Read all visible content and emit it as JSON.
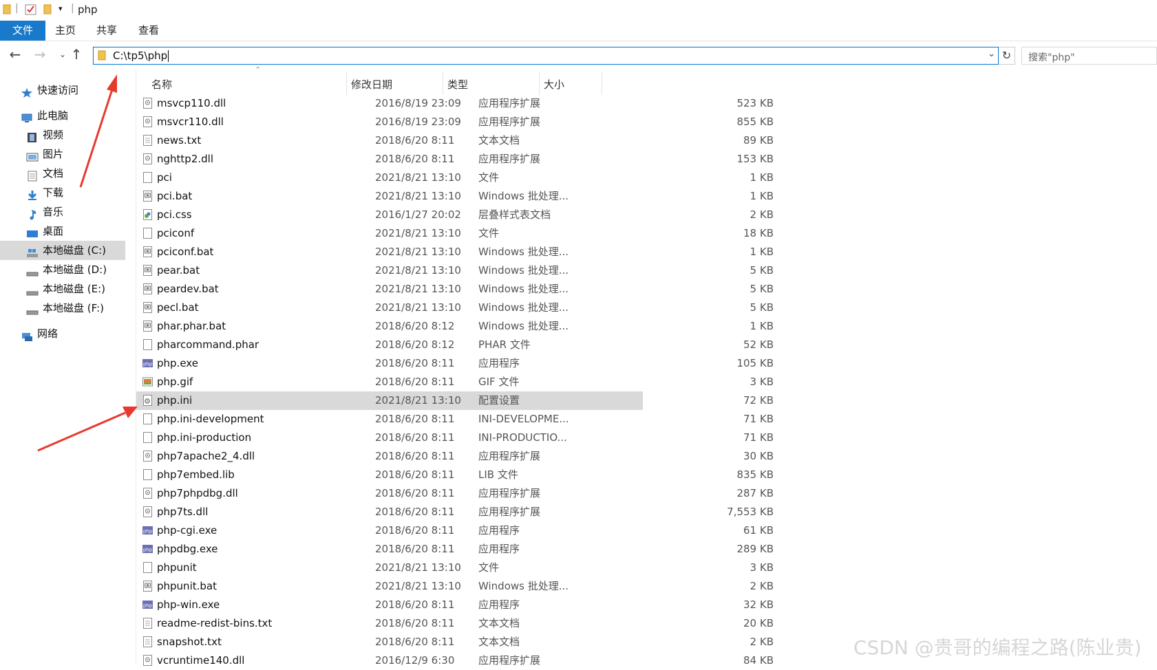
{
  "window": {
    "title": "php"
  },
  "ribbon": {
    "tabs": [
      "文件",
      "主页",
      "共享",
      "查看"
    ]
  },
  "address": {
    "path": "C:\\tp5\\php"
  },
  "search": {
    "placeholder": "搜索\"php\""
  },
  "nav": {
    "quick_access": "快速访问",
    "this_pc": "此电脑",
    "items": [
      "视频",
      "图片",
      "文档",
      "下载",
      "音乐",
      "桌面"
    ],
    "drives": [
      "本地磁盘 (C:)",
      "本地磁盘 (D:)",
      "本地磁盘 (E:)",
      "本地磁盘 (F:)"
    ],
    "network": "网络"
  },
  "columns": {
    "name": "名称",
    "date": "修改日期",
    "type": "类型",
    "size": "大小"
  },
  "files": [
    {
      "name": "msvcp110.dll",
      "date": "2016/8/19 23:09",
      "type": "应用程序扩展",
      "size": "523 KB",
      "icon": "dll"
    },
    {
      "name": "msvcr110.dll",
      "date": "2016/8/19 23:09",
      "type": "应用程序扩展",
      "size": "855 KB",
      "icon": "dll"
    },
    {
      "name": "news.txt",
      "date": "2018/6/20 8:11",
      "type": "文本文档",
      "size": "89 KB",
      "icon": "txt"
    },
    {
      "name": "nghttp2.dll",
      "date": "2018/6/20 8:11",
      "type": "应用程序扩展",
      "size": "153 KB",
      "icon": "dll"
    },
    {
      "name": "pci",
      "date": "2021/8/21 13:10",
      "type": "文件",
      "size": "1 KB",
      "icon": "blank"
    },
    {
      "name": "pci.bat",
      "date": "2021/8/21 13:10",
      "type": "Windows 批处理...",
      "size": "1 KB",
      "icon": "bat"
    },
    {
      "name": "pci.css",
      "date": "2016/1/27 20:02",
      "type": "层叠样式表文档",
      "size": "2 KB",
      "icon": "css"
    },
    {
      "name": "pciconf",
      "date": "2021/8/21 13:10",
      "type": "文件",
      "size": "18 KB",
      "icon": "blank"
    },
    {
      "name": "pciconf.bat",
      "date": "2021/8/21 13:10",
      "type": "Windows 批处理...",
      "size": "1 KB",
      "icon": "bat"
    },
    {
      "name": "pear.bat",
      "date": "2021/8/21 13:10",
      "type": "Windows 批处理...",
      "size": "5 KB",
      "icon": "bat"
    },
    {
      "name": "peardev.bat",
      "date": "2021/8/21 13:10",
      "type": "Windows 批处理...",
      "size": "5 KB",
      "icon": "bat"
    },
    {
      "name": "pecl.bat",
      "date": "2021/8/21 13:10",
      "type": "Windows 批处理...",
      "size": "5 KB",
      "icon": "bat"
    },
    {
      "name": "phar.phar.bat",
      "date": "2018/6/20 8:12",
      "type": "Windows 批处理...",
      "size": "1 KB",
      "icon": "bat"
    },
    {
      "name": "pharcommand.phar",
      "date": "2018/6/20 8:12",
      "type": "PHAR 文件",
      "size": "52 KB",
      "icon": "blank"
    },
    {
      "name": "php.exe",
      "date": "2018/6/20 8:11",
      "type": "应用程序",
      "size": "105 KB",
      "icon": "php"
    },
    {
      "name": "php.gif",
      "date": "2018/6/20 8:11",
      "type": "GIF 文件",
      "size": "3 KB",
      "icon": "gif"
    },
    {
      "name": "php.ini",
      "date": "2021/8/21 13:10",
      "type": "配置设置",
      "size": "72 KB",
      "icon": "ini",
      "selected": true
    },
    {
      "name": "php.ini-development",
      "date": "2018/6/20 8:11",
      "type": "INI-DEVELOPME...",
      "size": "71 KB",
      "icon": "blank"
    },
    {
      "name": "php.ini-production",
      "date": "2018/6/20 8:11",
      "type": "INI-PRODUCTIO...",
      "size": "71 KB",
      "icon": "blank"
    },
    {
      "name": "php7apache2_4.dll",
      "date": "2018/6/20 8:11",
      "type": "应用程序扩展",
      "size": "30 KB",
      "icon": "dll"
    },
    {
      "name": "php7embed.lib",
      "date": "2018/6/20 8:11",
      "type": "LIB 文件",
      "size": "835 KB",
      "icon": "blank"
    },
    {
      "name": "php7phpdbg.dll",
      "date": "2018/6/20 8:11",
      "type": "应用程序扩展",
      "size": "287 KB",
      "icon": "dll"
    },
    {
      "name": "php7ts.dll",
      "date": "2018/6/20 8:11",
      "type": "应用程序扩展",
      "size": "7,553 KB",
      "icon": "dll"
    },
    {
      "name": "php-cgi.exe",
      "date": "2018/6/20 8:11",
      "type": "应用程序",
      "size": "61 KB",
      "icon": "php"
    },
    {
      "name": "phpdbg.exe",
      "date": "2018/6/20 8:11",
      "type": "应用程序",
      "size": "289 KB",
      "icon": "php"
    },
    {
      "name": "phpunit",
      "date": "2021/8/21 13:10",
      "type": "文件",
      "size": "3 KB",
      "icon": "blank"
    },
    {
      "name": "phpunit.bat",
      "date": "2021/8/21 13:10",
      "type": "Windows 批处理...",
      "size": "2 KB",
      "icon": "bat"
    },
    {
      "name": "php-win.exe",
      "date": "2018/6/20 8:11",
      "type": "应用程序",
      "size": "32 KB",
      "icon": "php"
    },
    {
      "name": "readme-redist-bins.txt",
      "date": "2018/6/20 8:11",
      "type": "文本文档",
      "size": "20 KB",
      "icon": "txt"
    },
    {
      "name": "snapshot.txt",
      "date": "2018/6/20 8:11",
      "type": "文本文档",
      "size": "2 KB",
      "icon": "txt"
    },
    {
      "name": "vcruntime140.dll",
      "date": "2016/12/9 6:30",
      "type": "应用程序扩展",
      "size": "84 KB",
      "icon": "dll"
    }
  ],
  "watermark": "CSDN @贵哥的编程之路(陈业贵)",
  "colors": {
    "accent": "#1979ca",
    "selection": "#d9d9d9",
    "annotation_arrow": "#e8392f"
  }
}
